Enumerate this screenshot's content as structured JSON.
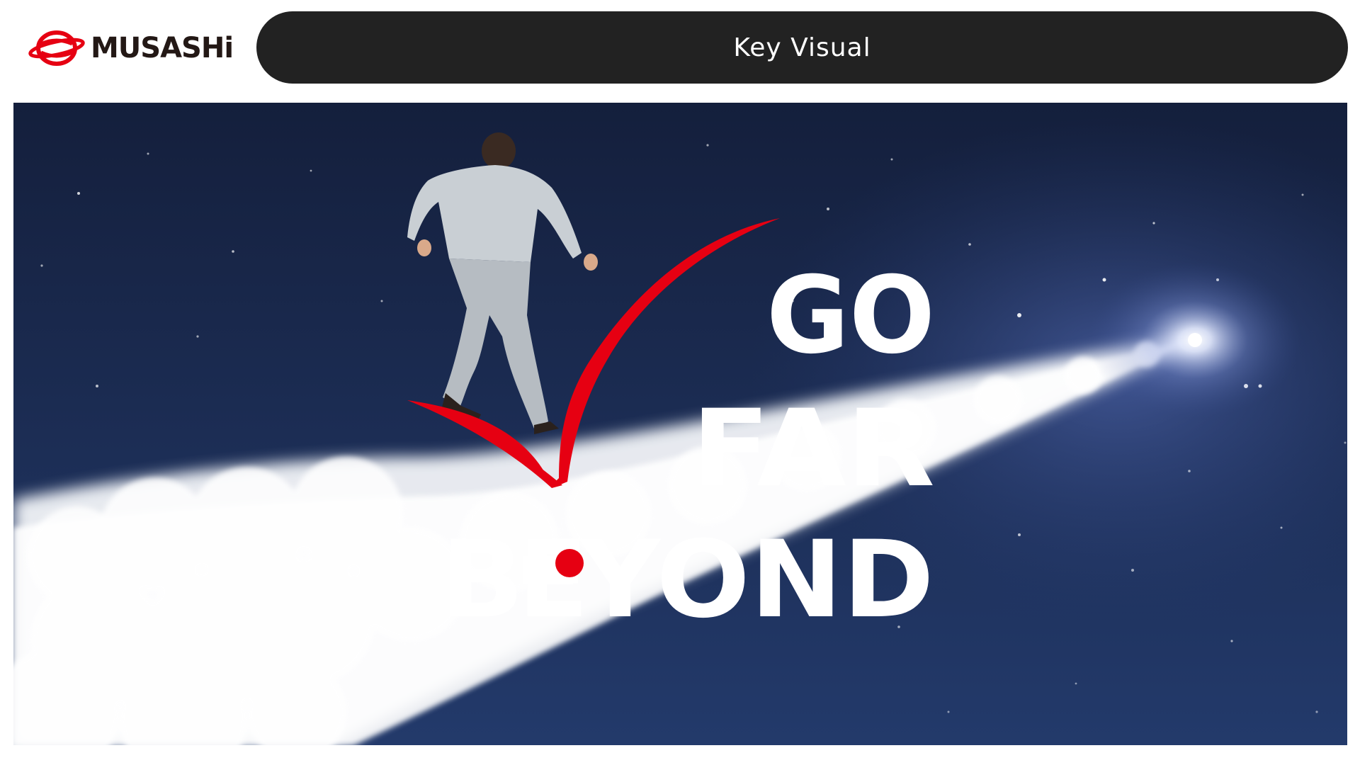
{
  "brand": {
    "name": "MUSASHi",
    "accent": "#e60012",
    "text_color": "#231815"
  },
  "header": {
    "title": "Key Visual",
    "pill_color": "#222222"
  },
  "key_visual": {
    "headline": {
      "line1": "GO",
      "line2": "FAR",
      "line3_part1": "B",
      "line3_part2": "E",
      "line3_part3": "YOND"
    },
    "colors": {
      "sky_top": "#141f3c",
      "sky_bottom": "#233a6b",
      "smoke": "#f2f4f8",
      "check_mark": "#e60012",
      "headline_text": "#ffffff"
    },
    "elements": [
      "running-man-figure",
      "rocket-smoke-trail",
      "red-check-mark",
      "glowing-light-source",
      "stars"
    ]
  }
}
